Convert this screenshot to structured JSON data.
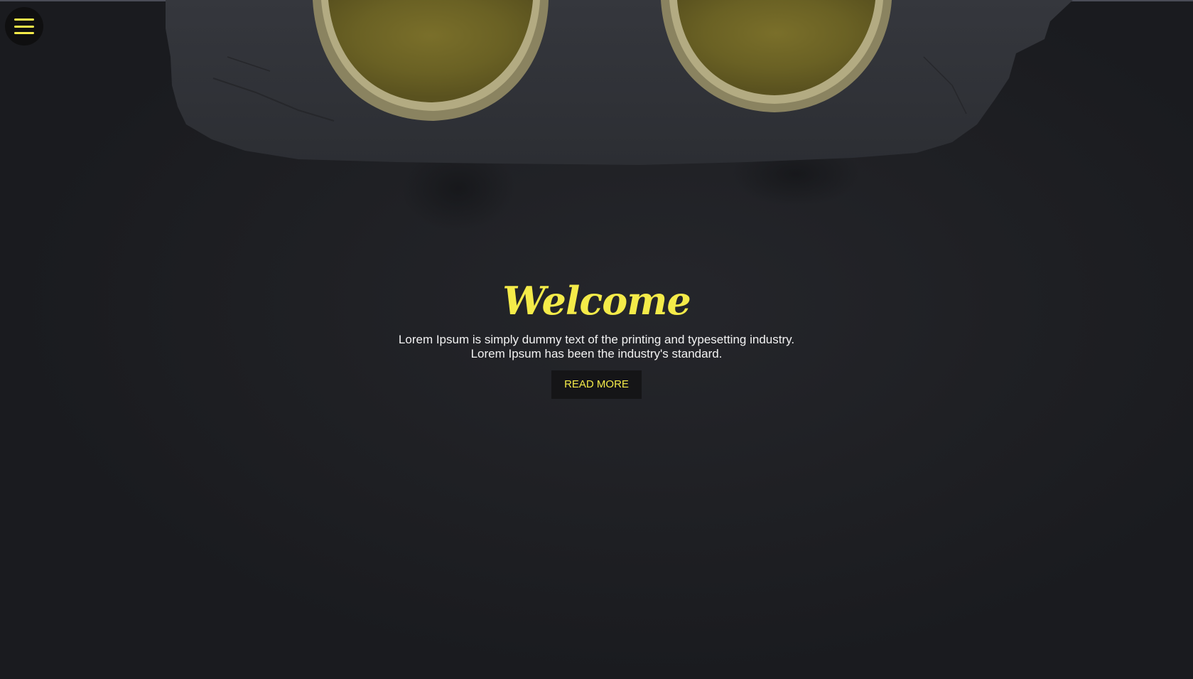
{
  "nav": {
    "menu_icon": "hamburger-menu-icon",
    "accent_color": "#f4eb49"
  },
  "hero": {
    "title": "Welcome",
    "description_line1": "Lorem Ipsum is simply dummy text of the printing and typesetting industry.",
    "description_line2": "Lorem Ipsum has been the industry's standard.",
    "button_label": "READ MORE",
    "background_color": "#1d1e22"
  }
}
